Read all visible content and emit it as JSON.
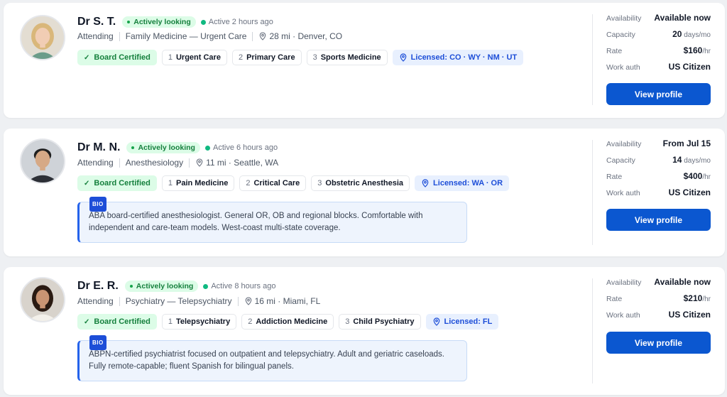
{
  "colors": {
    "accent": "#0b57d0",
    "status_green": "#15803d",
    "license_blue": "#1d4ed8"
  },
  "cards": [
    {
      "name": "Dr S. T.",
      "status": "Actively looking",
      "active": "Active 2 hours ago",
      "role": "Attending",
      "specialty": "Family Medicine — Urgent Care",
      "location": "28 mi · Denver, CO",
      "cert": "Board Certified",
      "tags": [
        {
          "num": "1",
          "label": "Urgent Care"
        },
        {
          "num": "2",
          "label": "Primary Care"
        },
        {
          "num": "3",
          "label": "Sports Medicine"
        }
      ],
      "license": "Licensed: CO · WY · NM · UT",
      "stats": [
        {
          "label": "Availability",
          "value": "Available now",
          "unit": ""
        },
        {
          "label": "Capacity",
          "value": "20",
          "unit": " days/mo"
        },
        {
          "label": "Rate",
          "value": "$160",
          "unit": "/hr"
        },
        {
          "label": "Work auth",
          "value": "US Citizen",
          "unit": ""
        }
      ],
      "button": "View profile"
    },
    {
      "name": "Dr M. N.",
      "status": "Actively looking",
      "active": "Active 6 hours ago",
      "role": "Attending",
      "specialty": "Anesthesiology",
      "location": "11 mi · Seattle, WA",
      "cert": "Board Certified",
      "tags": [
        {
          "num": "1",
          "label": "Pain Medicine"
        },
        {
          "num": "2",
          "label": "Critical Care"
        },
        {
          "num": "3",
          "label": "Obstetric Anesthesia"
        }
      ],
      "license": "Licensed: WA · OR",
      "bio_badge": "BIO",
      "bio": "ABA board-certified anesthesiologist. General OR, OB and regional blocks. Comfortable with independent and care-team models. West-coast multi-state coverage.",
      "stats": [
        {
          "label": "Availability",
          "value": "From Jul 15",
          "unit": ""
        },
        {
          "label": "Capacity",
          "value": "14",
          "unit": " days/mo"
        },
        {
          "label": "Rate",
          "value": "$400",
          "unit": "/hr"
        },
        {
          "label": "Work auth",
          "value": "US Citizen",
          "unit": ""
        }
      ],
      "button": "View profile"
    },
    {
      "name": "Dr E. R.",
      "status": "Actively looking",
      "active": "Active 8 hours ago",
      "role": "Attending",
      "specialty": "Psychiatry — Telepsychiatry",
      "location": "16 mi · Miami, FL",
      "cert": "Board Certified",
      "tags": [
        {
          "num": "1",
          "label": "Telepsychiatry"
        },
        {
          "num": "2",
          "label": "Addiction Medicine"
        },
        {
          "num": "3",
          "label": "Child Psychiatry"
        }
      ],
      "license": "Licensed: FL",
      "bio_badge": "BIO",
      "bio": "ABPN-certified psychiatrist focused on outpatient and telepsychiatry. Adult and geriatric caseloads. Fully remote-capable; fluent Spanish for bilingual panels.",
      "stats": [
        {
          "label": "Availability",
          "value": "Available now",
          "unit": ""
        },
        {
          "label": "Rate",
          "value": "$210",
          "unit": "/hr"
        },
        {
          "label": "Work auth",
          "value": "US Citizen",
          "unit": ""
        }
      ],
      "button": "View profile"
    }
  ]
}
